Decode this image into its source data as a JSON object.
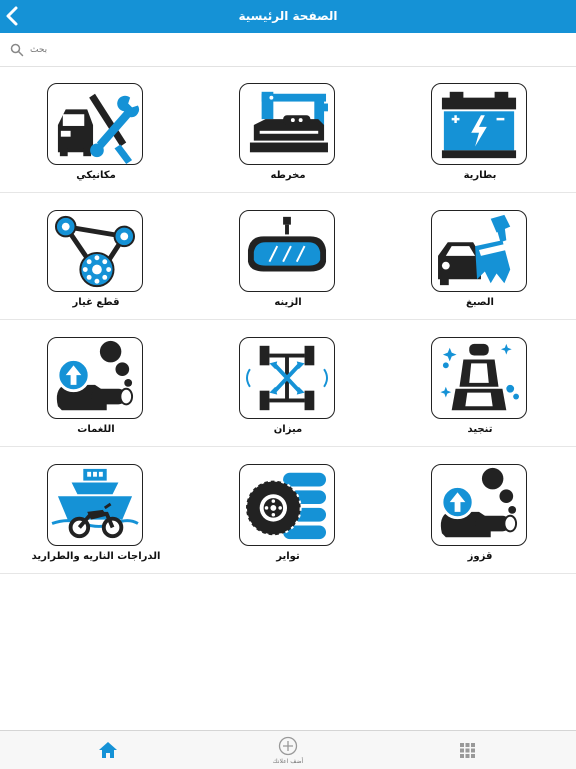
{
  "header": {
    "title": "الصفحة الرئيسية",
    "back_icon": "chevron-left-icon",
    "background_color": "#1592d6"
  },
  "search": {
    "placeholder": "بحث",
    "icon": "search-icon"
  },
  "categories": [
    {
      "label": "مكانيكي",
      "icon": "mechanic-tools-icon"
    },
    {
      "label": "مخرطه",
      "icon": "lathe-machine-icon"
    },
    {
      "label": "بطارية",
      "icon": "battery-icon"
    },
    {
      "label": "قطع غيار",
      "icon": "timing-belt-icon"
    },
    {
      "label": "الزينه",
      "icon": "rearview-mirror-icon"
    },
    {
      "label": "الصبغ",
      "icon": "car-paint-brush-icon"
    },
    {
      "label": "اللغمات",
      "icon": "exhaust-upgrade-icon"
    },
    {
      "label": "ميزان",
      "icon": "wheel-alignment-icon"
    },
    {
      "label": "تنجيد",
      "icon": "car-seat-icon"
    },
    {
      "label": "الدراجات الناريه والطراريد",
      "icon": "boat-motorcycle-icon"
    },
    {
      "label": "تواير",
      "icon": "tire-icon"
    },
    {
      "label": "قزوز",
      "icon": "exhaust-icon"
    }
  ],
  "bottom_nav": {
    "home_icon": "home-icon",
    "add_label": "أضف اعلانك",
    "add_icon": "plus-circle-icon",
    "grid_icon": "grid-icon"
  },
  "colors": {
    "accent": "#1592d6",
    "icon_dark": "#222222"
  }
}
